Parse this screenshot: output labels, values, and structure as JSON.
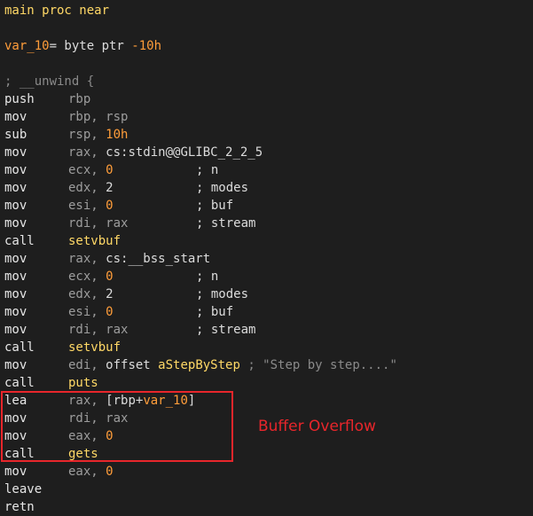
{
  "header": {
    "proc_name": "main",
    "proc_kw": " proc near"
  },
  "var_decl": {
    "name": "var_10",
    "rest": "= byte ptr ",
    "value": "-10h"
  },
  "unwind_comment": "; __unwind {",
  "instructions": [
    {
      "op": "push",
      "args": [
        {
          "t": "reg",
          "v": "rbp"
        }
      ],
      "comment": ""
    },
    {
      "op": "mov",
      "args": [
        {
          "t": "reg",
          "v": "rbp, rsp"
        }
      ],
      "comment": ""
    },
    {
      "op": "sub",
      "args": [
        {
          "t": "reg",
          "v": "rsp, "
        },
        {
          "t": "num",
          "v": "10h"
        }
      ],
      "comment": ""
    },
    {
      "op": "mov",
      "args": [
        {
          "t": "reg",
          "v": "rax, "
        },
        {
          "t": "op",
          "v": "cs:stdin@@GLIBC_2_2_5"
        }
      ],
      "comment": ""
    },
    {
      "op": "mov",
      "args": [
        {
          "t": "reg",
          "v": "ecx, "
        },
        {
          "t": "num",
          "v": "0"
        }
      ],
      "comment": "; n"
    },
    {
      "op": "mov",
      "args": [
        {
          "t": "reg",
          "v": "edx, "
        },
        {
          "t": "op",
          "v": "2"
        }
      ],
      "comment": "; modes"
    },
    {
      "op": "mov",
      "args": [
        {
          "t": "reg",
          "v": "esi, "
        },
        {
          "t": "num",
          "v": "0"
        }
      ],
      "comment": "; buf"
    },
    {
      "op": "mov",
      "args": [
        {
          "t": "reg",
          "v": "rdi, rax"
        }
      ],
      "comment": "; stream"
    },
    {
      "op": "call",
      "args": [
        {
          "t": "func",
          "v": "setvbuf"
        }
      ],
      "comment": ""
    },
    {
      "op": "mov",
      "args": [
        {
          "t": "reg",
          "v": "rax, "
        },
        {
          "t": "op",
          "v": "cs:__bss_start"
        }
      ],
      "comment": ""
    },
    {
      "op": "mov",
      "args": [
        {
          "t": "reg",
          "v": "ecx, "
        },
        {
          "t": "num",
          "v": "0"
        }
      ],
      "comment": "; n"
    },
    {
      "op": "mov",
      "args": [
        {
          "t": "reg",
          "v": "edx, "
        },
        {
          "t": "op",
          "v": "2"
        }
      ],
      "comment": "; modes"
    },
    {
      "op": "mov",
      "args": [
        {
          "t": "reg",
          "v": "esi, "
        },
        {
          "t": "num",
          "v": "0"
        }
      ],
      "comment": "; buf"
    },
    {
      "op": "mov",
      "args": [
        {
          "t": "reg",
          "v": "rdi, rax"
        }
      ],
      "comment": "; stream"
    },
    {
      "op": "call",
      "args": [
        {
          "t": "func",
          "v": "setvbuf"
        }
      ],
      "comment": ""
    },
    {
      "op": "mov",
      "args": [
        {
          "t": "reg",
          "v": "edi, "
        },
        {
          "t": "op",
          "v": "offset "
        },
        {
          "t": "func",
          "v": "aStepByStep"
        },
        {
          "t": "comment",
          "v": " ; \"Step by step....\""
        }
      ],
      "comment": ""
    },
    {
      "op": "call",
      "args": [
        {
          "t": "func",
          "v": "puts"
        }
      ],
      "comment": ""
    },
    {
      "op": "lea",
      "args": [
        {
          "t": "reg",
          "v": "rax, "
        },
        {
          "t": "op",
          "v": "[rbp+"
        },
        {
          "t": "var",
          "v": "var_10"
        },
        {
          "t": "op",
          "v": "]"
        }
      ],
      "comment": ""
    },
    {
      "op": "mov",
      "args": [
        {
          "t": "reg",
          "v": "rdi, rax"
        }
      ],
      "comment": ""
    },
    {
      "op": "mov",
      "args": [
        {
          "t": "reg",
          "v": "eax, "
        },
        {
          "t": "num",
          "v": "0"
        }
      ],
      "comment": ""
    },
    {
      "op": "call",
      "args": [
        {
          "t": "func",
          "v": "gets"
        }
      ],
      "comment": ""
    },
    {
      "op": "mov",
      "args": [
        {
          "t": "reg",
          "v": "eax, "
        },
        {
          "t": "num",
          "v": "0"
        }
      ],
      "comment": ""
    },
    {
      "op": "leave",
      "args": [],
      "comment": ""
    },
    {
      "op": "retn",
      "args": [],
      "comment": ""
    }
  ],
  "annotation": {
    "text": "Buffer Overflow",
    "color": "#e8262b"
  }
}
